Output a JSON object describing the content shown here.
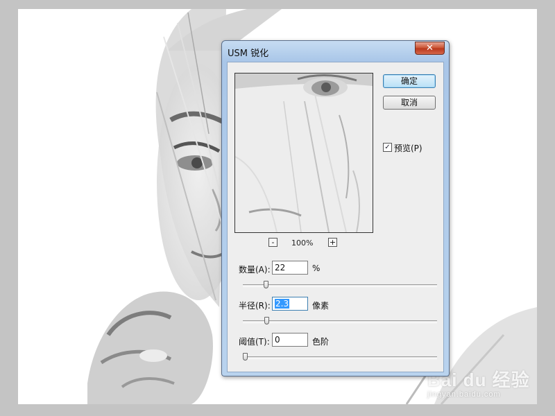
{
  "dialog": {
    "title": "USM 锐化",
    "ok_label": "确定",
    "cancel_label": "取消",
    "preview_checked": true,
    "preview_label": "预览(P)",
    "zoom": {
      "zoom_out_label": "-",
      "zoom_level": "100%",
      "zoom_in_label": "+"
    },
    "params": [
      {
        "label": "数量(A):",
        "value": "22",
        "unit": "%",
        "slider_fraction": 0.11
      },
      {
        "label": "半径(R):",
        "value": "2.3",
        "unit": "像素",
        "slider_fraction": 0.115
      },
      {
        "label": "阈值(T):",
        "value": "0",
        "unit": "色阶",
        "slider_fraction": 0.0
      }
    ]
  },
  "watermark": {
    "text": "Bai du 经验",
    "subtext": "jingyan.baidu.com"
  },
  "colors": {
    "titlebar": "#b9d3ee",
    "close_button": "#c9502f",
    "default_button": "#b9e0f6",
    "dialog_background": "#eeeeee",
    "workspace": "#c4c4c4"
  }
}
